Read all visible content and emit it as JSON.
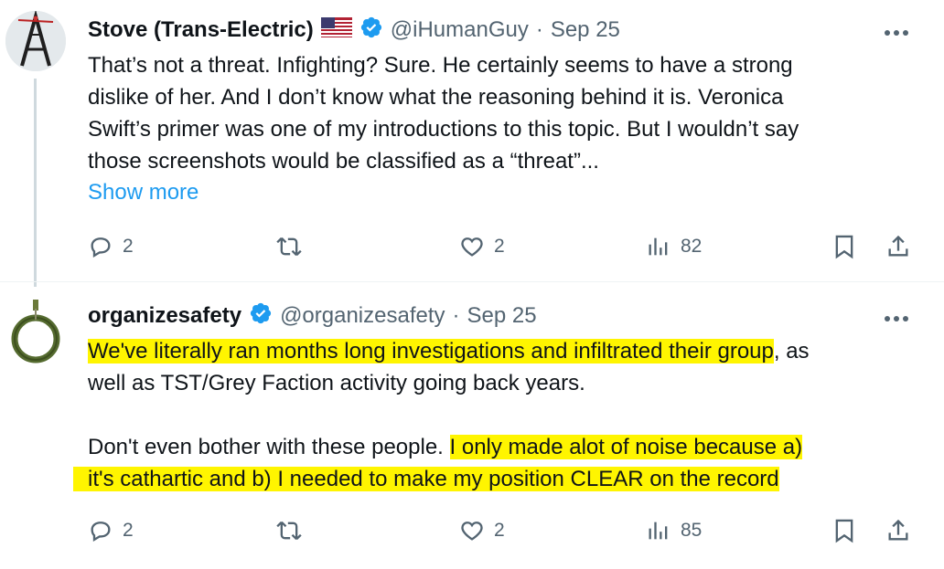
{
  "tweets": [
    {
      "display_name": "Stove (Trans-Electric)",
      "handle": "@iHumanGuy",
      "separator": "·",
      "date": "Sep 25",
      "flag": "🇺🇸",
      "lines": [
        "That’s not a threat. Infighting? Sure. He certainly seems to have a strong",
        "dislike of her. And I don’t know what the reasoning behind it is. Veronica",
        "Swift’s primer was one of my introductions to this topic. But I wouldn’t say",
        "those screenshots would be classified as a “threat”..."
      ],
      "show_more": "Show more",
      "replies": "2",
      "likes": "2",
      "views": "82"
    },
    {
      "display_name": "organizesafety",
      "handle": "@organizesafety",
      "separator": "·",
      "date": "Sep 25",
      "line1_highlight": "We've literally ran months long investigations and infiltrated their group",
      "line1_rest": ", as",
      "line2": "well as TST/Grey Faction activity going back years.",
      "line3_plain": "Don't even bother with these people. ",
      "line3_highlight": "I only made alot of noise because a)",
      "line4_highlight": "it's cathartic and b) I needed to make my position CLEAR on the record",
      "replies": "2",
      "likes": "2",
      "views": "85"
    }
  ],
  "icons": {
    "verified": "verified-badge-icon",
    "more": "more-icon",
    "reply": "reply-icon",
    "retweet": "retweet-icon",
    "like": "like-icon",
    "views": "views-icon",
    "bookmark": "bookmark-icon",
    "share": "share-icon"
  },
  "colors": {
    "accent": "#1d9bf0",
    "highlight": "#fff500",
    "muted": "#536471"
  }
}
